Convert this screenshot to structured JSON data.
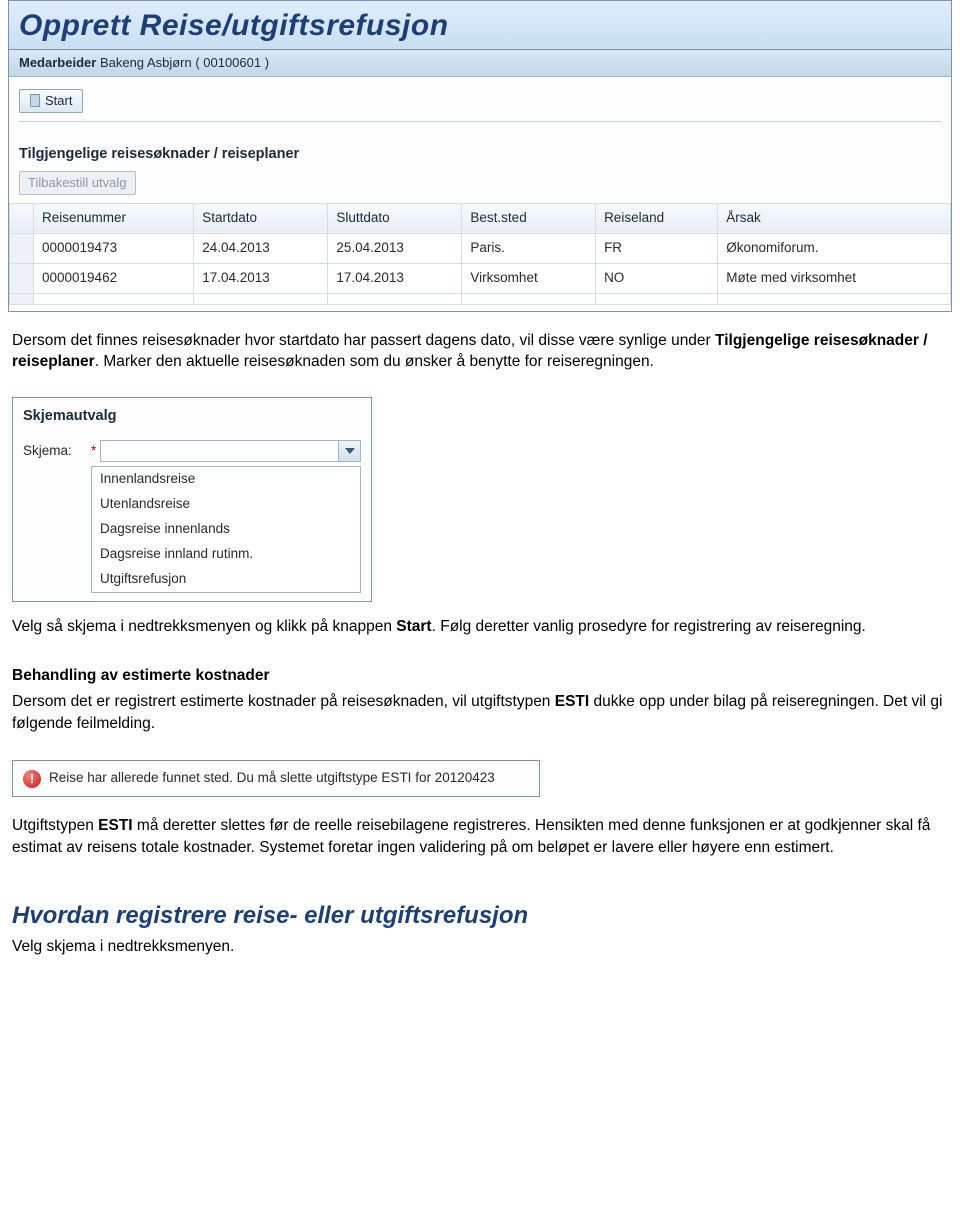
{
  "window": {
    "title": "Opprett Reise/utgiftsrefusjon",
    "subheader_label": "Medarbeider",
    "subheader_value": "Bakeng Asbjørn ( 00100601 )",
    "start_button": "Start",
    "list_section_title": "Tilgjengelige reisesøknader / reiseplaner",
    "reset_button": "Tilbakestill utvalg",
    "table": {
      "headers": [
        "Reisenummer",
        "Startdato",
        "Sluttdato",
        "Best.sted",
        "Reiseland",
        "Årsak"
      ],
      "rows": [
        [
          "0000019473",
          "24.04.2013",
          "25.04.2013",
          "Paris.",
          "FR",
          "Økonomiforum."
        ],
        [
          "0000019462",
          "17.04.2013",
          "17.04.2013",
          "Virksomhet",
          "NO",
          "Møte med virksomhet"
        ]
      ]
    }
  },
  "para1_a": "Dersom det finnes reisesøknader hvor startdato har passert dagens dato, vil disse være synlige under",
  "para1_b": "Tilgjengelige reisesøknader / reiseplaner",
  "para1_c": ". Marker den aktuelle reisesøknaden som du ønsker å benytte for reiseregningen.",
  "form_panel": {
    "title": "Skjemautvalg",
    "field_label": "Skjema:",
    "options": [
      "Innenlandsreise",
      "Utenlandsreise",
      "Dagsreise innenlands",
      "Dagsreise innland rutinm.",
      "Utgiftsrefusjon"
    ]
  },
  "para2_a": "Velg så skjema i nedtrekksmenyen og klikk på knappen ",
  "para2_b": "Start",
  "para2_c": ". Følg deretter vanlig prosedyre for registrering av reiseregning.",
  "para3_hd": "Behandling av estimerte kostnader",
  "para3_a": "Dersom det er registrert estimerte kostnader på reisesøknaden, vil utgiftstypen ",
  "para3_b": "ESTI",
  "para3_c": " dukke opp under bilag på reiseregningen. Det vil gi følgende feilmelding.",
  "error_message": "Reise har allerede funnet sted. Du må slette utgiftstype ESTI for 20120423",
  "para4_a": "Utgiftstypen ",
  "para4_b": "ESTI",
  "para4_c": " må deretter slettes før de reelle reisebilagene registreres. Hensikten med denne funksjonen er at godkjenner skal få estimat av reisens totale kostnader. Systemet foretar ingen validering på om beløpet er lavere eller høyere enn estimert.",
  "heading2": "Hvordan registrere reise- eller utgiftsrefusjon",
  "para5": "Velg skjema i nedtrekksmenyen."
}
